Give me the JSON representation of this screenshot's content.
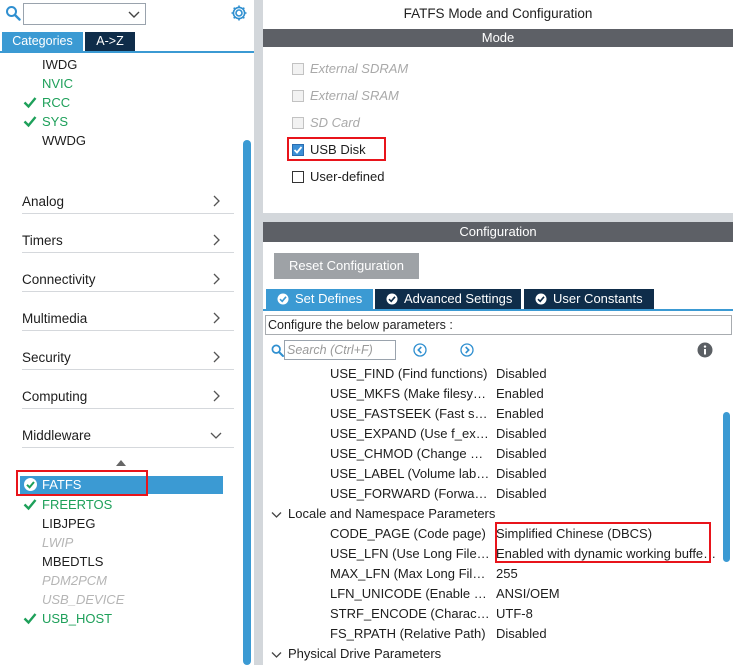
{
  "colors": {
    "accent": "#3b9ad3",
    "navy": "#0f2d4a",
    "enabled_green": "#1ea05a",
    "highlight_red": "#e8141b",
    "band_gray": "#5d6066"
  },
  "left": {
    "search_combo_value": "",
    "tabs": [
      {
        "label": "Categories",
        "active": true
      },
      {
        "label": "A->Z",
        "active": false
      }
    ],
    "system_core_items": [
      {
        "label": "IWDG",
        "state": "normal",
        "checked": false
      },
      {
        "label": "NVIC",
        "state": "enabled",
        "checked": false
      },
      {
        "label": "RCC",
        "state": "enabled",
        "checked": true
      },
      {
        "label": "SYS",
        "state": "enabled",
        "checked": true
      },
      {
        "label": "WWDG",
        "state": "normal",
        "checked": false
      }
    ],
    "categories": [
      {
        "label": "Analog",
        "expanded": false
      },
      {
        "label": "Timers",
        "expanded": false
      },
      {
        "label": "Connectivity",
        "expanded": false
      },
      {
        "label": "Multimedia",
        "expanded": false
      },
      {
        "label": "Security",
        "expanded": false
      },
      {
        "label": "Computing",
        "expanded": false
      },
      {
        "label": "Middleware",
        "expanded": true
      }
    ],
    "middleware_items": [
      {
        "label": "FATFS",
        "state": "selected",
        "checked": true
      },
      {
        "label": "FREERTOS",
        "state": "enabled",
        "checked": true
      },
      {
        "label": "LIBJPEG",
        "state": "normal",
        "checked": false
      },
      {
        "label": "LWIP",
        "state": "disabled",
        "checked": false
      },
      {
        "label": "MBEDTLS",
        "state": "normal",
        "checked": false
      },
      {
        "label": "PDM2PCM",
        "state": "disabled",
        "checked": false
      },
      {
        "label": "USB_DEVICE",
        "state": "disabled",
        "checked": false
      },
      {
        "label": "USB_HOST",
        "state": "enabled",
        "checked": true
      }
    ]
  },
  "right": {
    "title": "FATFS Mode and Configuration",
    "mode_header": "Mode",
    "mode_options": [
      {
        "label": "External SDRAM",
        "enabled": false,
        "checked": false
      },
      {
        "label": "External SRAM",
        "enabled": false,
        "checked": false
      },
      {
        "label": "SD Card",
        "enabled": false,
        "checked": false
      },
      {
        "label": "USB Disk",
        "enabled": true,
        "checked": true
      },
      {
        "label": "User-defined",
        "enabled": true,
        "checked": false
      }
    ],
    "config_header": "Configuration",
    "reset_button": "Reset Configuration",
    "config_tabs": [
      {
        "label": "Set Defines",
        "active": true
      },
      {
        "label": "Advanced Settings",
        "active": false
      },
      {
        "label": "User Constants",
        "active": false
      }
    ],
    "configure_hint": "Configure the below parameters :",
    "search_placeholder": "Search (Ctrl+F)",
    "params": [
      {
        "type": "param",
        "name": "USE_FIND (Find functions)",
        "value": "Disabled"
      },
      {
        "type": "param",
        "name": "USE_MKFS (Make filesystem)",
        "value": "Enabled"
      },
      {
        "type": "param",
        "name": "USE_FASTSEEK (Fast seek)",
        "value": "Enabled"
      },
      {
        "type": "param",
        "name": "USE_EXPAND (Use f_expand)",
        "value": "Disabled"
      },
      {
        "type": "param",
        "name": "USE_CHMOD (Change attributes)",
        "value": "Disabled"
      },
      {
        "type": "param",
        "name": "USE_LABEL (Volume label)",
        "value": "Disabled"
      },
      {
        "type": "param",
        "name": "USE_FORWARD (Forward function)",
        "value": "Disabled"
      },
      {
        "type": "group",
        "name": "Locale and Namespace Parameters"
      },
      {
        "type": "param",
        "name": "CODE_PAGE (Code page)",
        "value": "Simplified Chinese (DBCS)"
      },
      {
        "type": "param",
        "name": "USE_LFN (Use Long File Name)",
        "value": "Enabled with dynamic working buffer on the HEAP"
      },
      {
        "type": "param",
        "name": "MAX_LFN (Max Long File Name)",
        "value": "255"
      },
      {
        "type": "param",
        "name": "LFN_UNICODE (Enable Unicode)",
        "value": "ANSI/OEM"
      },
      {
        "type": "param",
        "name": "STRF_ENCODE (Character encoding)",
        "value": "UTF-8"
      },
      {
        "type": "param",
        "name": "FS_RPATH (Relative Path)",
        "value": "Disabled"
      },
      {
        "type": "group",
        "name": "Physical Drive Parameters"
      }
    ]
  }
}
